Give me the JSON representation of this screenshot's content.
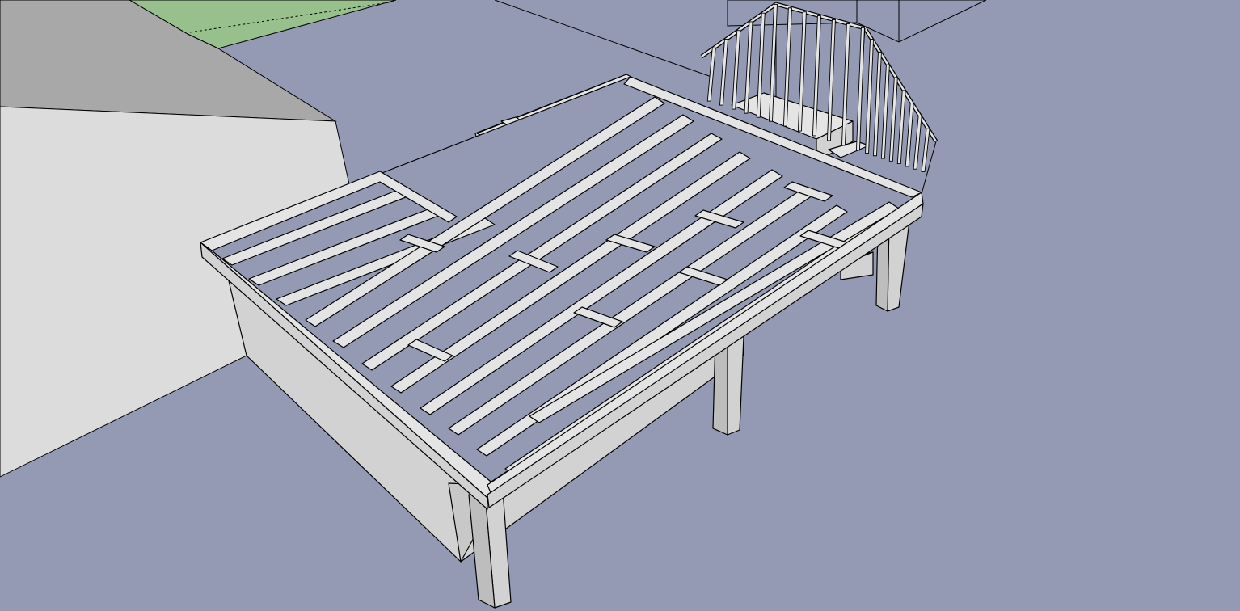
{
  "viewport": {
    "background": "#959ab4",
    "colors": {
      "ground": "#959ab4",
      "lawn": "#97c08d",
      "roof": "#a8a8a8",
      "house_wall": "#dcdcdc",
      "lumber_top": "#e4e4e4",
      "lumber_side": "#d2d2d2",
      "edge": "#000000"
    }
  },
  "model": {
    "joist_count": 12,
    "post_count": 4,
    "railing_baluster_count": 20
  }
}
